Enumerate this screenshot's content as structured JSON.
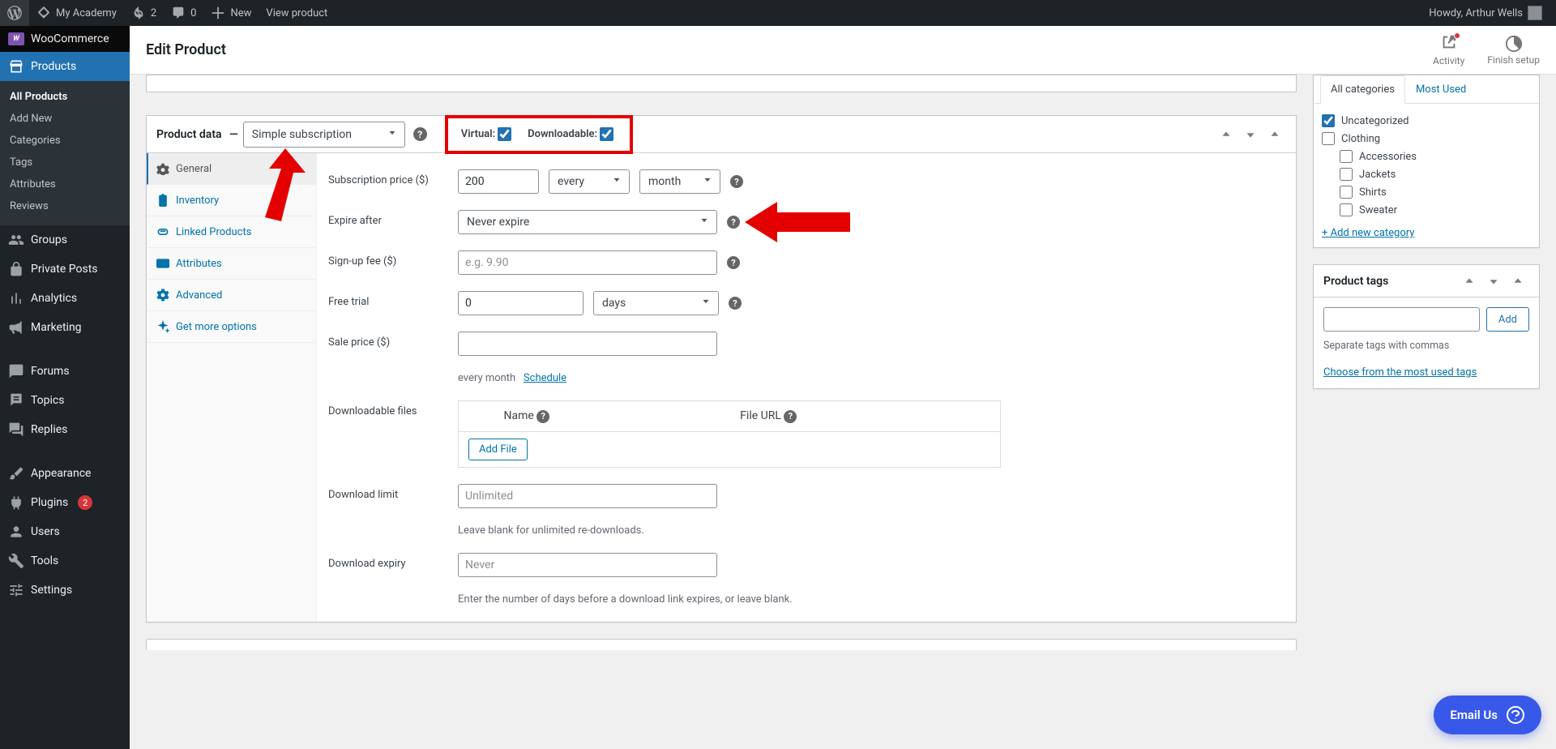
{
  "adminbar": {
    "site": "My Academy",
    "updates": "2",
    "comments": "0",
    "new": "New",
    "view": "View product",
    "howdy": "Howdy, Arthur Wells"
  },
  "sidebar": {
    "woo": "WooCommerce",
    "products": "Products",
    "sub": [
      "All Products",
      "Add New",
      "Categories",
      "Tags",
      "Attributes",
      "Reviews"
    ],
    "groups": "Groups",
    "private": "Private Posts",
    "analytics": "Analytics",
    "marketing": "Marketing",
    "forums": "Forums",
    "topics": "Topics",
    "replies": "Replies",
    "appearance": "Appearance",
    "plugins": "Plugins",
    "plugins_badge": "2",
    "users": "Users",
    "tools": "Tools",
    "settings": "Settings"
  },
  "header": {
    "title": "Edit Product",
    "activity": "Activity",
    "finish": "Finish setup"
  },
  "productdata": {
    "title": "Product data",
    "select": "Simple subscription",
    "virtual_lbl": "Virtual:",
    "downloadable_lbl": "Downloadable:",
    "virtual_checked": true,
    "downloadable_checked": true,
    "tabs": {
      "general": "General",
      "inventory": "Inventory",
      "linked": "Linked Products",
      "attributes": "Attributes",
      "advanced": "Advanced",
      "more": "Get more options"
    },
    "fields": {
      "sub_price_lbl": "Subscription price ($)",
      "sub_price_val": "200",
      "interval_val": "every",
      "period_val": "month",
      "expire_lbl": "Expire after",
      "expire_val": "Never expire",
      "signup_lbl": "Sign-up fee ($)",
      "signup_ph": "e.g. 9.90",
      "trial_lbl": "Free trial",
      "trial_val": "0",
      "trial_unit": "days",
      "sale_lbl": "Sale price ($)",
      "sale_note_prefix": "every month",
      "schedule": "Schedule",
      "dl_files_lbl": "Downloadable files",
      "name_hdr": "Name",
      "fileurl_hdr": "File URL",
      "add_file": "Add File",
      "dl_limit_lbl": "Download limit",
      "dl_limit_ph": "Unlimited",
      "dl_limit_note": "Leave blank for unlimited re-downloads.",
      "dl_expiry_lbl": "Download expiry",
      "dl_expiry_ph": "Never",
      "dl_expiry_note": "Enter the number of days before a download link expires, or leave blank."
    }
  },
  "categories": {
    "tab_all": "All categories",
    "tab_most": "Most Used",
    "items": [
      {
        "label": "Uncategorized",
        "checked": true
      },
      {
        "label": "Clothing",
        "checked": false
      },
      {
        "label": "Accessories",
        "checked": false,
        "indent": true
      },
      {
        "label": "Jackets",
        "checked": false,
        "indent": true
      },
      {
        "label": "Shirts",
        "checked": false,
        "indent": true
      },
      {
        "label": "Sweater",
        "checked": false,
        "indent": true
      }
    ],
    "add_new": "+ Add new category"
  },
  "tags": {
    "title": "Product tags",
    "add": "Add",
    "separate": "Separate tags with commas",
    "choose": "Choose from the most used tags"
  },
  "widget": {
    "email": "Email Us"
  }
}
